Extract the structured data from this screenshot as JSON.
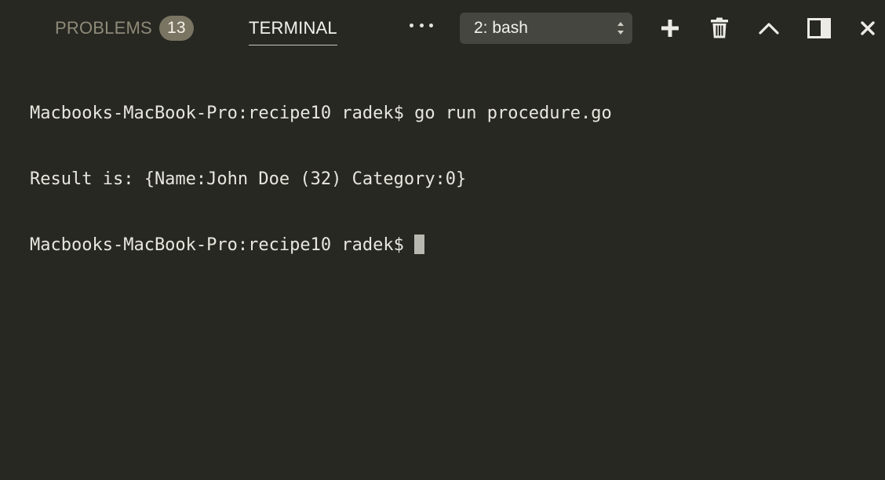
{
  "tabs": {
    "problems": {
      "label": "PROBLEMS",
      "count": "13"
    },
    "terminal": {
      "label": "TERMINAL"
    }
  },
  "terminal_selector": {
    "selected": "2: bash"
  },
  "toolbar": {
    "more_icon": "ellipsis-icon",
    "add_icon": "plus-icon",
    "trash_icon": "trash-icon",
    "maximize_icon": "chevron-up-icon",
    "split_icon": "split-panel-icon",
    "close_icon": "close-icon"
  },
  "terminal": {
    "lines": [
      "Macbooks-MacBook-Pro:recipe10 radek$ go run procedure.go",
      "Result is: {Name:John Doe (32) Category:0}"
    ],
    "prompt": "Macbooks-MacBook-Pro:recipe10 radek$"
  },
  "colors": {
    "background": "#272822",
    "text": "#e8e6df",
    "inactive_tab": "#8e8a78",
    "badge": "#7a7462",
    "select_bg": "#45463f"
  }
}
